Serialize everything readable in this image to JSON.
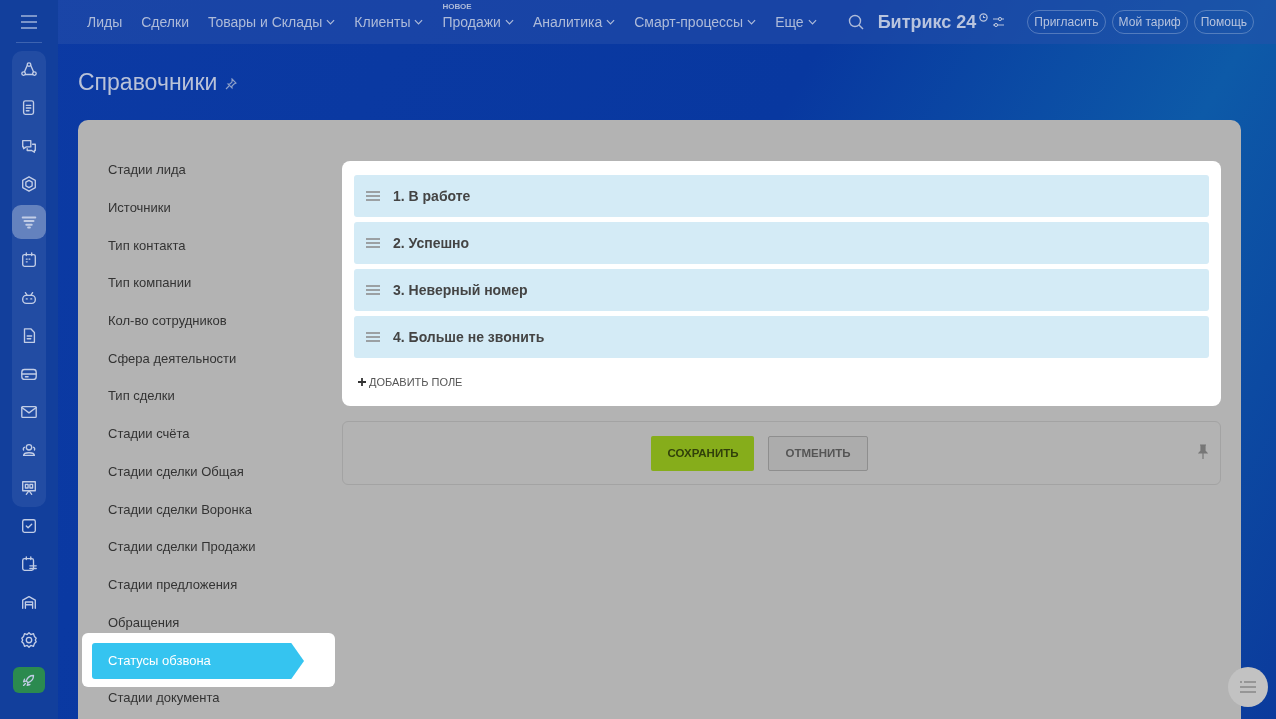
{
  "sidebar": {
    "icons": [
      {
        "selected": false
      },
      {
        "selected": false
      },
      {
        "selected": false
      },
      {
        "selected": false
      },
      {
        "selected": true
      },
      {
        "selected": false
      },
      {
        "selected": false
      },
      {
        "selected": false
      },
      {
        "selected": false
      },
      {
        "selected": false
      },
      {
        "selected": false
      },
      {
        "selected": false
      },
      {
        "selected": false
      },
      {
        "selected": false
      },
      {
        "selected": false
      },
      {
        "selected": false
      }
    ]
  },
  "nav": {
    "items": [
      {
        "label": "Лиды",
        "dropdown": false
      },
      {
        "label": "Сделки",
        "dropdown": false
      },
      {
        "label": "Товары и Склады",
        "dropdown": true
      },
      {
        "label": "Клиенты",
        "dropdown": true
      },
      {
        "label": "Продажи",
        "dropdown": true,
        "badge": "НОВОЕ"
      },
      {
        "label": "Аналитика",
        "dropdown": true
      },
      {
        "label": "Смарт-процессы",
        "dropdown": true
      },
      {
        "label": "Еще",
        "dropdown": true
      }
    ],
    "logo": "Битрикс 24",
    "buttons": [
      "Пригласить",
      "Мой тариф",
      "Помощь"
    ]
  },
  "page": {
    "title": "Справочники"
  },
  "menu": {
    "items": [
      {
        "label": "Стадии лида",
        "selected": false
      },
      {
        "label": "Источники",
        "selected": false
      },
      {
        "label": "Тип контакта",
        "selected": false
      },
      {
        "label": "Тип компании",
        "selected": false
      },
      {
        "label": "Кол-во сотрудников",
        "selected": false
      },
      {
        "label": "Сфера деятельности",
        "selected": false
      },
      {
        "label": "Тип сделки",
        "selected": false
      },
      {
        "label": "Стадии счёта",
        "selected": false
      },
      {
        "label": "Стадии сделки Общая",
        "selected": false
      },
      {
        "label": "Стадии сделки Воронка",
        "selected": false
      },
      {
        "label": "Стадии сделки Продажи",
        "selected": false
      },
      {
        "label": "Стадии предложения",
        "selected": false
      },
      {
        "label": "Обращения",
        "selected": false
      },
      {
        "label": "Статусы обзвона",
        "selected": true
      },
      {
        "label": "Стадии документа",
        "selected": false
      }
    ]
  },
  "statuses": [
    "1. В работе",
    "2. Успешно",
    "3. Неверный номер",
    "4. Больше не звонить"
  ],
  "add_field": "ДОБАВИТЬ ПОЛЕ",
  "actions": [
    {
      "label": "СОХРАНИТЬ",
      "kind": "primary"
    },
    {
      "label": "ОТМЕНИТЬ",
      "kind": "secondary"
    }
  ]
}
